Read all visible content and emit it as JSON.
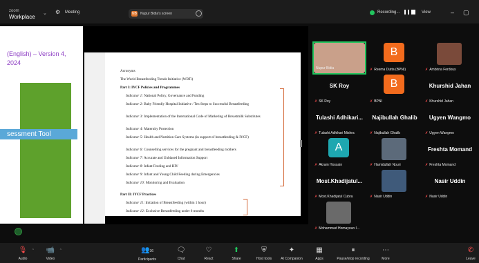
{
  "app": {
    "brand_small": "zoom",
    "brand_big": "Workplace",
    "meeting_label": "Meeting"
  },
  "share": {
    "presenter_initials": "NB",
    "presenter_screen": "Nupur Bidia's screen",
    "slide_title_line1": "(English) – Version 4,",
    "slide_title_line2": "2024",
    "slide_tool_label": "sessment Tool",
    "doc": {
      "acronyms": "Acronyms",
      "wbti": "The World Breastfeeding Trends Initiative (WBTi)",
      "part1": "Part I: IYCF Policies and Programmes",
      "indicators1": [
        {
          "n": "Indicator 1:",
          "t": "National Policy, Governance and Funding"
        },
        {
          "n": "Indicator 2:",
          "t": "Baby Friendly Hospital Initiative / Ten Steps to Successful Breastfeeding"
        },
        {
          "n": "Indicator 3:",
          "t": "Implementation of the International Code of Marketing of Breastmilk Substitutes"
        },
        {
          "n": "Indicator 4:",
          "t": "Maternity Protection"
        },
        {
          "n": "Indicator 5:",
          "t": "Health and Nutrition Care Systems (in support of breastfeeding & IYCF)"
        },
        {
          "n": "Indicator 6:",
          "t": "Counselling services for the pregnant and breastfeeding mothers"
        },
        {
          "n": "Indicator 7:",
          "t": "Accurate and Unbiased Information Support"
        },
        {
          "n": "Indicator 8:",
          "t": "Infant Feeding and HIV"
        },
        {
          "n": "Indicator 9:",
          "t": "Infant and Young Child Feeding during Emergencies"
        },
        {
          "n": "Indicator 10:",
          "t": "Monitoring and Evaluation"
        }
      ],
      "part2": "Part II: IYCF Practices",
      "indicators2": [
        {
          "n": "Indicator 11:",
          "t": "Initiation of Breastfeeding (within 1 hour)"
        },
        {
          "n": "Indicator 12:",
          "t": "Exclusive Breastfeeding under 6 months"
        }
      ]
    }
  },
  "status": {
    "recording": "Recording...",
    "view": "View"
  },
  "participants": [
    {
      "name": "Nupur Bidia",
      "type": "video"
    },
    {
      "name": "Reema Dutta (BPNI)",
      "type": "letter",
      "letter": "B",
      "color": "#f26b1d"
    },
    {
      "name": "Ambrina Ferdous",
      "type": "video"
    },
    {
      "name": "SK Roy",
      "display": "SK Roy",
      "type": "name"
    },
    {
      "name": "BPNI",
      "type": "letter",
      "letter": "B",
      "color": "#f26b1d"
    },
    {
      "name": "Khurshid Jahan",
      "display": "Khurshid Jahan",
      "type": "name"
    },
    {
      "name": "Tulashi Adhikari Mishra",
      "display": "Tulashi  Adhikari...",
      "type": "name"
    },
    {
      "name": "Najibullah Ghalib",
      "display": "Najibullah Ghalib",
      "type": "name"
    },
    {
      "name": "Ugyen Wangmo",
      "display": "Ugyen Wangmo",
      "type": "name"
    },
    {
      "name": "Akram Hossain",
      "type": "letter",
      "letter": "A",
      "color": "#1ea7b0"
    },
    {
      "name": "Hamidullah Nouri",
      "type": "video"
    },
    {
      "name": "Freshta Momand",
      "display": "Freshta Momand",
      "type": "name"
    },
    {
      "name": "Most.Khadijatul Cubra",
      "display": "Most.Khadijatul...",
      "type": "name"
    },
    {
      "name": "Nasir Uddin",
      "type": "video"
    },
    {
      "name": "Nasir Uddin",
      "display": "Nasir Uddin",
      "type": "name"
    },
    {
      "name": "Mohammad Homayoun I...",
      "type": "video"
    }
  ],
  "toolbar": {
    "audio": "Audio",
    "video": "Video",
    "participants": "Participants",
    "participants_count": "36",
    "chat": "Chat",
    "react": "React",
    "share": "Share",
    "host_tools": "Host tools",
    "ai_companion": "AI Companion",
    "apps": "Apps",
    "pause_stop": "Pause/stop recording",
    "more": "More",
    "leave": "Leave"
  },
  "colors": {
    "accent_green": "#22c55e",
    "slide_purple": "#8e3fc4",
    "mute_red": "#ff4d4d"
  }
}
